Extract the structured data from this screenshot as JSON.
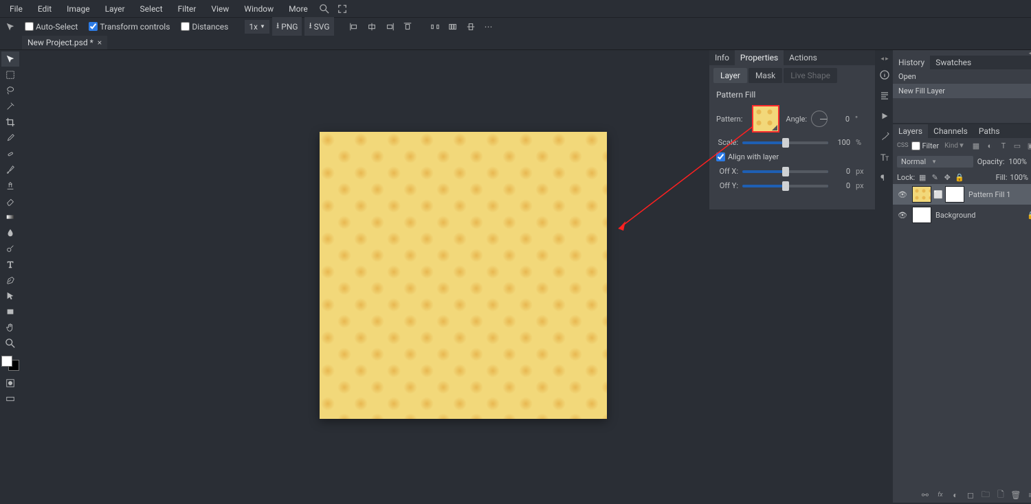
{
  "menu": {
    "items": [
      "File",
      "Edit",
      "Image",
      "Layer",
      "Select",
      "Filter",
      "View",
      "Window",
      "More"
    ]
  },
  "options": {
    "auto_select": "Auto-Select",
    "transform": "Transform controls",
    "distance": "Distances",
    "zoom": "1x",
    "png": "PNG",
    "svg": "SVG",
    "sizeindicator": "⬚"
  },
  "tab": {
    "title": "New Project.psd *",
    "close": "×"
  },
  "properties": {
    "tabs": [
      "Info",
      "Properties",
      "Actions"
    ],
    "subtabs": [
      "Layer",
      "Mask",
      "Live Shape"
    ],
    "title": "Pattern Fill",
    "pattern_label": "Pattern:",
    "angle_label": "Angle:",
    "angle_val": "0",
    "angle_unit": "°",
    "scale_label": "Scale:",
    "scale_val": "100",
    "scale_unit": "%",
    "align_label": "Align with layer",
    "offx_label": "Off X:",
    "offx_val": "0",
    "offx_unit": "px",
    "offy_label": "Off Y:",
    "offy_val": "0",
    "offy_unit": "px"
  },
  "history": {
    "tabs": [
      "History",
      "Swatches"
    ],
    "items": [
      "Open",
      "New Fill Layer"
    ]
  },
  "layers": {
    "tabs": [
      "Layers",
      "Channels",
      "Paths"
    ],
    "css": "CSS",
    "filter_label": "Filter",
    "kind": "Kind",
    "blend": "Normal",
    "opacity_label": "Opacity:",
    "opacity_val": "100%",
    "lock_label": "Lock:",
    "fill_label": "Fill:",
    "fill_val": "100%",
    "rows": [
      {
        "name": "Pattern Fill 1",
        "mask": true,
        "locked": false,
        "sel": true
      },
      {
        "name": "Background",
        "mask": false,
        "locked": true,
        "sel": false
      }
    ]
  }
}
